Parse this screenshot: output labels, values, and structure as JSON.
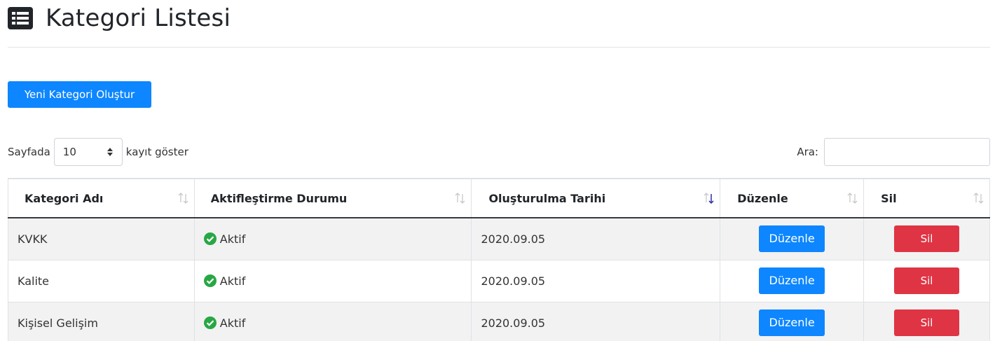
{
  "page": {
    "title": "Kategori Listesi",
    "title_icon": "list-alt-icon"
  },
  "actions": {
    "new_category_label": "Yeni Kategori Oluştur"
  },
  "length_menu": {
    "prefix": "Sayfada",
    "selected": "10",
    "suffix": "kayıt göster"
  },
  "search": {
    "label": "Ara:",
    "value": "",
    "placeholder": ""
  },
  "table": {
    "columns": [
      "Kategori Adı",
      "Aktifleştirme Durumu",
      "Oluşturulma Tarihi",
      "Düzenle",
      "Sil"
    ],
    "sorted_column": "Oluşturulma Tarihi",
    "sort_direction": "descending",
    "rows": [
      {
        "name": "KVKK",
        "status": "Aktif",
        "created": "2020.09.05",
        "edit_label": "Düzenle",
        "delete_label": "Sil"
      },
      {
        "name": "Kalite",
        "status": "Aktif",
        "created": "2020.09.05",
        "edit_label": "Düzenle",
        "delete_label": "Sil"
      },
      {
        "name": "Kişisel Gelişim",
        "status": "Aktif",
        "created": "2020.09.05",
        "edit_label": "Düzenle",
        "delete_label": "Sil"
      }
    ]
  },
  "colors": {
    "primary": "#0d86ff",
    "danger": "#df3444",
    "success": "#28a745",
    "row_stripe": "#f2f2f2"
  }
}
